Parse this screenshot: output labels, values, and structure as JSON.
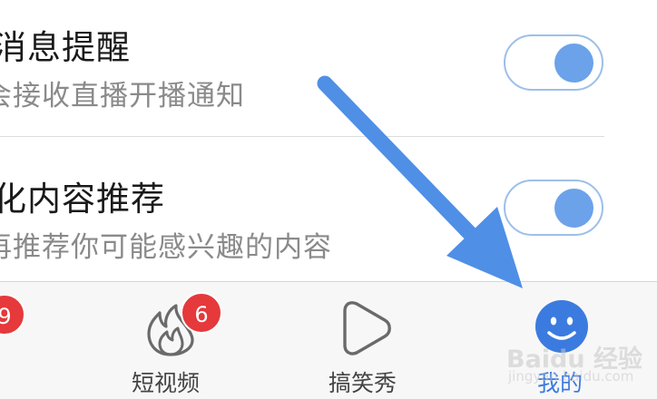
{
  "settings": {
    "rows": [
      {
        "title": "消息提醒",
        "subtitle": "会接收直播开播通知",
        "enabled": true
      },
      {
        "title": "化内容推荐",
        "subtitle": "再推荐你可能感兴趣的内容",
        "enabled": true
      }
    ]
  },
  "tabbar": {
    "tabs": [
      {
        "label": "",
        "badge": "9"
      },
      {
        "label": "短视频",
        "badge": "6",
        "icon": "flame-icon"
      },
      {
        "label": "搞笑秀",
        "icon": "play-triangle-icon"
      },
      {
        "label": "我的",
        "icon": "smiley-face-icon",
        "active": true
      }
    ]
  },
  "watermark": {
    "text": "Baidu 经验",
    "url": "jingyan.baidu.com"
  },
  "colors": {
    "accent": "#3b7be0",
    "toggle": "#6ba2ea",
    "badge": "#e5393c",
    "arrow": "#4f8fe6"
  }
}
